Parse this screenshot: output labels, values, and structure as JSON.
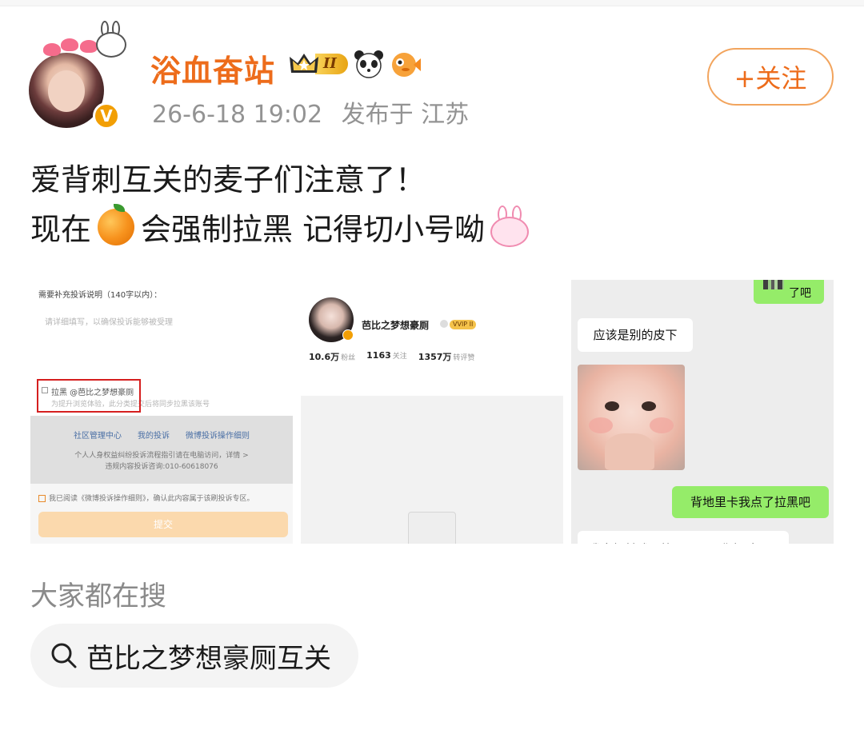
{
  "user": {
    "name": "浴血奋站",
    "verified_mark": "V",
    "level_badge": "II",
    "timestamp": "26-6-18 19:02",
    "location": "发布于 江苏"
  },
  "follow_button": {
    "label": "+关注"
  },
  "post": {
    "line1": "爱背刺互关的麦子们注意了！",
    "line2_before": "现在",
    "line2_after": "会强制拉黑 记得切小号呦"
  },
  "images": {
    "img1": {
      "header": "需要补充投诉说明（140字以内）：",
      "placeholder": "请详细填写，以确保投诉能够被受理",
      "block_label": "拉黑 @芭比之梦想豪厕",
      "block_hint": "为提升浏览体验，此分类提交后将同步拉黑该账号",
      "links": [
        "社区管理中心",
        "我的投诉",
        "微博投诉操作细则"
      ],
      "info1": "个人人身权益纠纷投诉流程指引请在电脑访问，详情 >",
      "info2": "违规内容投诉咨询:010-60618076",
      "agree": "我已阅读《微博投诉操作细则》，确认此内容属于该刷投诉专区。",
      "submit": "提交"
    },
    "img2": {
      "name": "芭比之梦想豪厕",
      "vvip": "VVIP II",
      "stats": [
        {
          "num": "10.6万",
          "label": "粉丝"
        },
        {
          "num": "1163",
          "label": "关注"
        },
        {
          "num": "1357万",
          "label": "转评赞"
        }
      ]
    },
    "img3": {
      "msg1": "了吧",
      "msg2": "应该是别的皮下",
      "msg3": "背地里卡我点了拉黑吧",
      "msg4": "我自打前述一笔，下面照你解除"
    }
  },
  "search_section": {
    "title": "大家都在搜",
    "query": "芭比之梦想豪厕互关"
  },
  "colors": {
    "accent_orange": "#ed6c1b",
    "follow_border": "#f2a45d",
    "meta_gray": "#939393",
    "wechat_green": "#95ec69",
    "red_box": "#d51f1f"
  },
  "icons": [
    "crown-icon",
    "panda-icon",
    "fish-icon",
    "orange-emoji",
    "bunny-emoji",
    "search-icon",
    "plus-icon"
  ]
}
